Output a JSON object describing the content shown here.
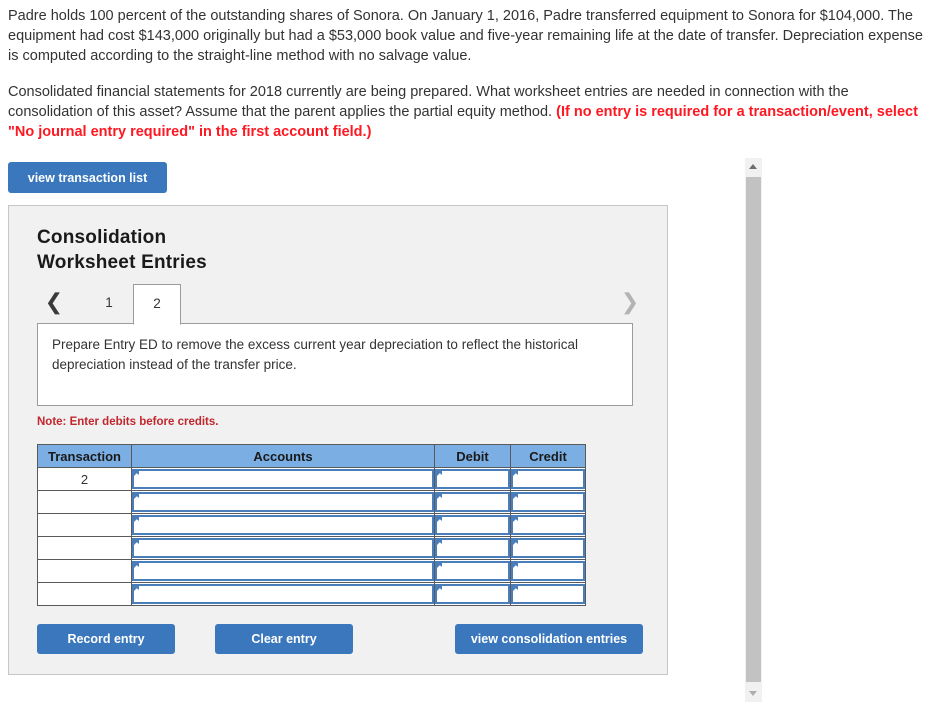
{
  "problem": {
    "paragraph1": "Padre holds 100 percent of the outstanding shares of Sonora. On January 1, 2016, Padre transferred equipment to Sonora for $104,000. The equipment had cost $143,000 originally but had a $53,000 book value and five-year remaining life at the date of transfer. Depreciation expense is computed according to the straight-line method with no salvage value.",
    "paragraph2_lead": "Consolidated financial statements for 2018 currently are being prepared. What worksheet entries are needed in connection with the consolidation of this asset? Assume that the parent applies the partial equity method. ",
    "paragraph2_emphasis": "(If no entry is required for a transaction/event, select \"No journal entry required\" in the first account field.)"
  },
  "toolbar": {
    "view_transaction_list_label": "view transaction list"
  },
  "card": {
    "title_line1": "Consolidation",
    "title_line2": "Worksheet Entries",
    "tabs": {
      "prev_icon": "chevron-left-icon",
      "next_icon": "chevron-right-icon",
      "items": [
        {
          "label": "1",
          "active": false
        },
        {
          "label": "2",
          "active": true
        }
      ]
    },
    "instruction": "Prepare Entry ED to remove the excess current year depreciation to reflect the historical depreciation instead of the transfer price.",
    "note": "Note: Enter debits before credits.",
    "table": {
      "headers": [
        "Transaction",
        "Accounts",
        "Debit",
        "Credit"
      ],
      "rows": [
        {
          "transaction": "2",
          "accounts": "",
          "debit": "",
          "credit": ""
        },
        {
          "transaction": "",
          "accounts": "",
          "debit": "",
          "credit": ""
        },
        {
          "transaction": "",
          "accounts": "",
          "debit": "",
          "credit": ""
        },
        {
          "transaction": "",
          "accounts": "",
          "debit": "",
          "credit": ""
        },
        {
          "transaction": "",
          "accounts": "",
          "debit": "",
          "credit": ""
        },
        {
          "transaction": "",
          "accounts": "",
          "debit": "",
          "credit": ""
        }
      ]
    },
    "buttons": {
      "record_entry": "Record entry",
      "clear_entry": "Clear entry",
      "view_consolidation_entries": "view consolidation entries"
    }
  },
  "scrollbar": {
    "up_icon": "triangle-up-icon",
    "down_icon": "triangle-down-icon"
  },
  "colors": {
    "button_blue": "#3a77bc",
    "table_header_blue": "#7bafe3",
    "field_border_blue": "#4a7ebb",
    "note_red": "#c1272d",
    "emphasis_red": "#ff1721",
    "card_background": "#f1f1f1"
  }
}
